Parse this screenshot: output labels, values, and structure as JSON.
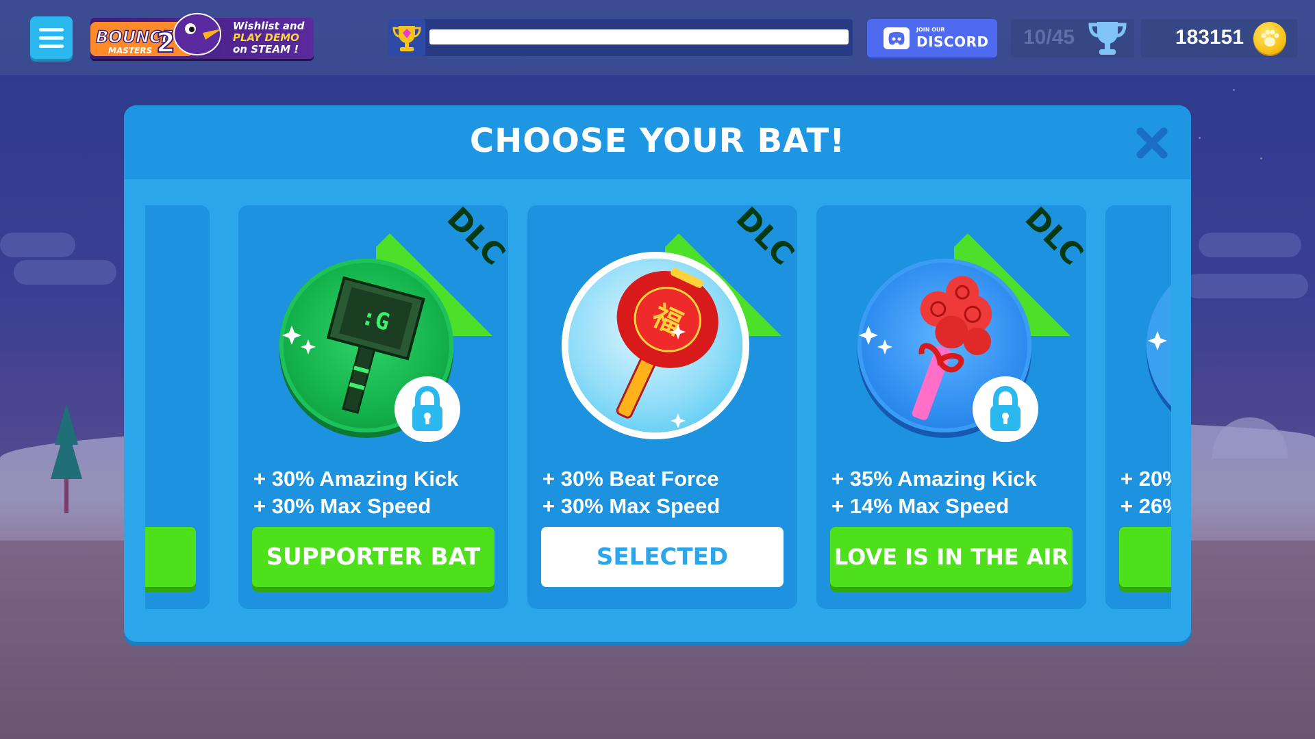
{
  "header": {
    "promo": {
      "logo_text": "BOUNCE 2 MASTERS",
      "line1": "Wishlist and",
      "line2": "PLAY DEMO",
      "line3": "on STEAM !"
    },
    "trophy_progress": 1.0,
    "discord": {
      "small": "JOIN OUR",
      "big": "DISCORD"
    },
    "cups": "10/45",
    "coins": "183151"
  },
  "modal": {
    "title": "CHOOSE YOUR BAT!"
  },
  "cards": [
    {
      "dlc": "DLC",
      "stat1": "+ 30% Amazing Kick",
      "stat2": "+ 30% Max Speed",
      "button": "SUPPORTER BAT",
      "locked": true
    },
    {
      "dlc": "DLC",
      "stat1": "+ 30% Beat Force",
      "stat2": "+ 30% Max Speed",
      "button": "SELECTED",
      "locked": false
    },
    {
      "dlc": "DLC",
      "stat1": "+ 35% Amazing Kick",
      "stat2": "+ 14% Max Speed",
      "button": "LOVE IS IN THE AIR",
      "locked": true
    },
    {
      "stat1": "+ 20%",
      "stat2": "+ 26%"
    }
  ],
  "colors": {
    "modal_bg": "#2ba6ea",
    "card_bg": "#1d92df",
    "dlc_green": "#4de02a",
    "button_green": "#4ee01a"
  }
}
